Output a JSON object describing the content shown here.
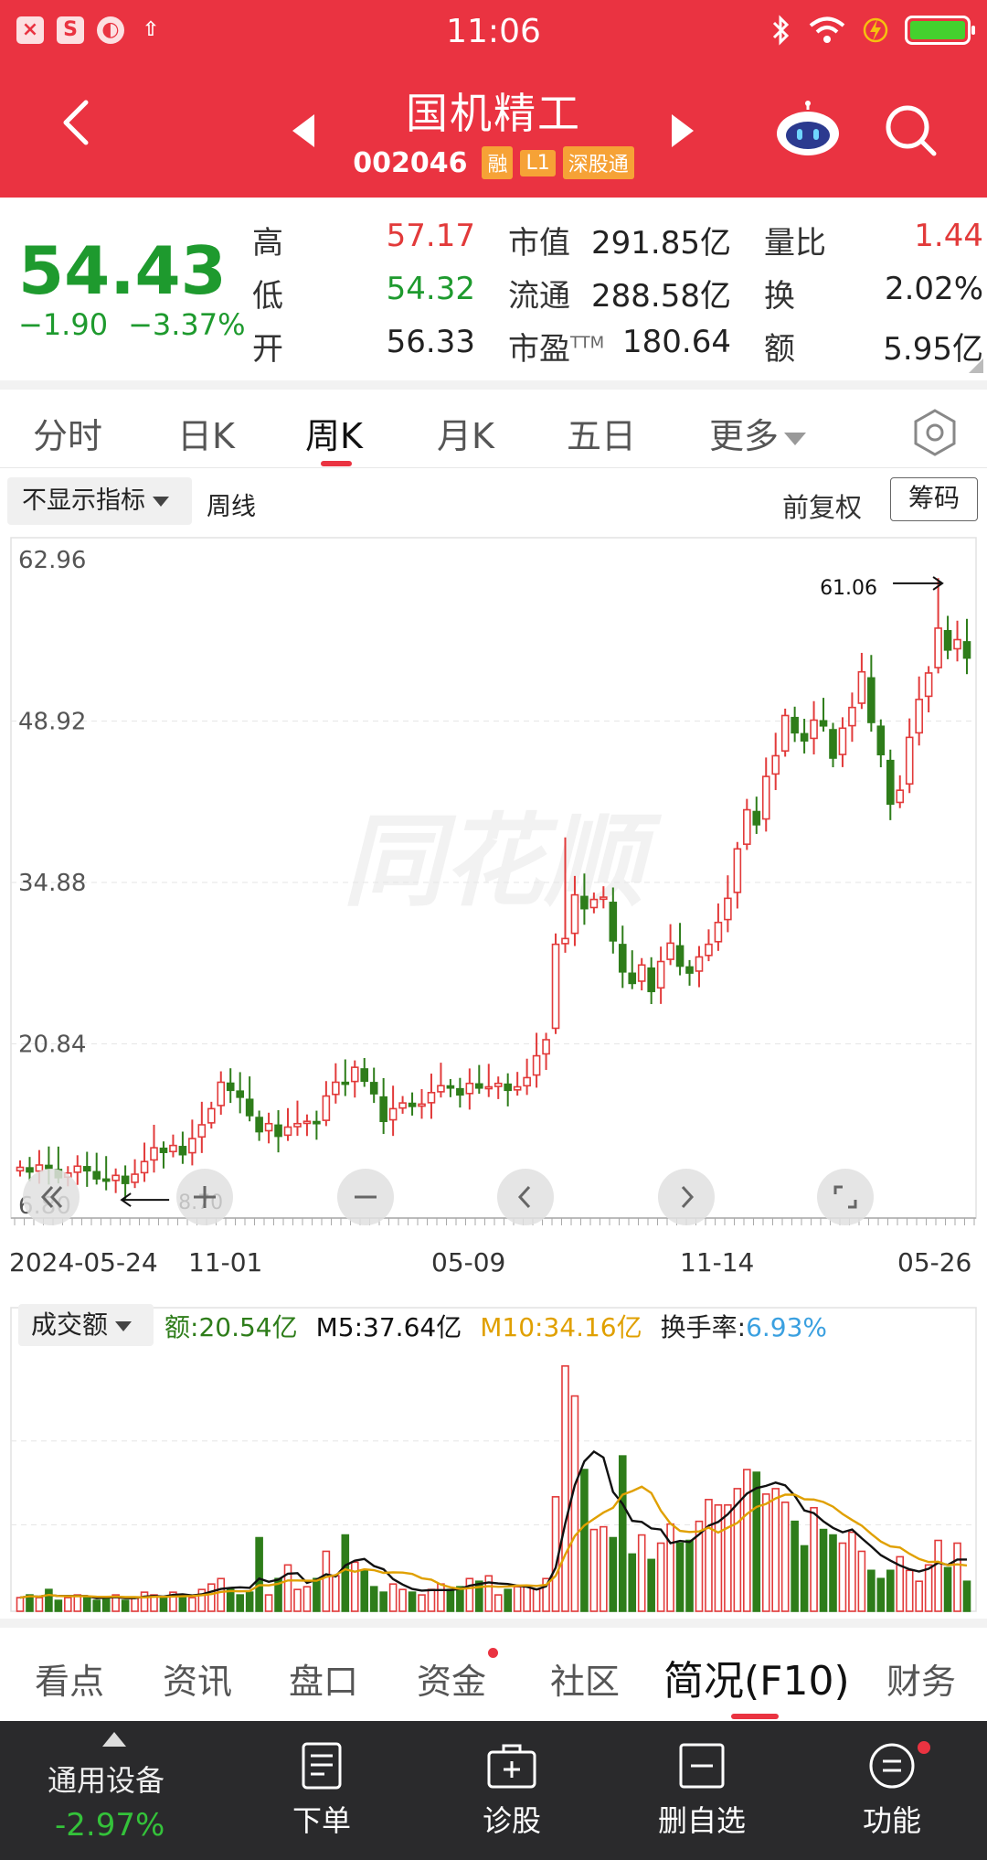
{
  "status_bar": {
    "time": "11:06"
  },
  "header": {
    "stock_name": "国机精工",
    "stock_code": "002046",
    "tags": [
      "融",
      "L1",
      "深股通"
    ]
  },
  "quote": {
    "price": "54.43",
    "change": "−1.90",
    "change_pct": "−3.37%",
    "high_label": "高",
    "high": "57.17",
    "low_label": "低",
    "low": "54.32",
    "open_label": "开",
    "open": "56.33",
    "mcap_label": "市值",
    "mcap": "291.85亿",
    "float_label": "流通",
    "float": "288.58亿",
    "pe_label": "市盈",
    "pe_sup": "TTM",
    "pe": "180.64",
    "vol_ratio_label": "量比",
    "vol_ratio": "1.44",
    "turnover_label": "换",
    "turnover": "2.02%",
    "amount_label": "额",
    "amount": "5.95亿"
  },
  "period_tabs": [
    "分时",
    "日K",
    "周K",
    "月K",
    "五日",
    "更多"
  ],
  "indicator": {
    "select": "不显示指标",
    "type": "周线",
    "adjust": "前复权",
    "chip_button": "筹码"
  },
  "watermark": "同花顺",
  "chart_data": [
    {
      "type": "candlestick",
      "period": "weekly",
      "ylim": [
        6.8,
        62.96
      ],
      "y_ticks": [
        "62.96",
        "48.92",
        "34.88",
        "20.84",
        "6.80"
      ],
      "x_tick_labels": [
        "2024-05-24",
        "11-01",
        "05-09",
        "11-14",
        "05-26"
      ],
      "max_annotation": "61.06",
      "min_annotation": "8.70",
      "closes": [
        10.1,
        9.7,
        10.3,
        10.0,
        9.2,
        9.6,
        10.2,
        9.8,
        9.1,
        8.9,
        9.4,
        8.7,
        9.5,
        10.6,
        11.8,
        11.4,
        12.0,
        11.2,
        12.6,
        13.8,
        15.2,
        17.5,
        16.8,
        16.2,
        14.6,
        13.2,
        13.9,
        12.8,
        13.6,
        13.9,
        14.1,
        13.9,
        16.3,
        17.5,
        17.4,
        18.8,
        17.6,
        16.5,
        14.1,
        15.2,
        15.7,
        15.4,
        15.6,
        16.6,
        17.2,
        17.0,
        16.4,
        17.4,
        17.0,
        17.1,
        17.4,
        16.8,
        17.1,
        17.9,
        19.8,
        21.2,
        29.5,
        30.0,
        33.8,
        32.6,
        33.4,
        33.6,
        29.8,
        27.1,
        26.1,
        27.7,
        25.4,
        28.0,
        29.6,
        27.6,
        27.0,
        28.4,
        29.5,
        31.4,
        33.5,
        37.8,
        41.2,
        39.9,
        44.1,
        45.9,
        49.4,
        47.9,
        47.2,
        49.0,
        48.5,
        45.7,
        48.3,
        50.1,
        53.2,
        48.8,
        46.0,
        41.7,
        42.9,
        47.5,
        50.8,
        53.1,
        57.0,
        55.1,
        56.0,
        54.4
      ],
      "candle_colors": "red = up (close ≥ open), green = down"
    },
    {
      "type": "bar",
      "title": "成交额",
      "series_label_amount": "额",
      "amount_value": "20.54亿",
      "m5_label": "M5",
      "m5_value": "37.64亿",
      "m10_label": "M10",
      "m10_value": "34.16亿",
      "turnover_label": "换手率",
      "turnover_value": "6.93%",
      "line_colors": {
        "m5": "#111111",
        "m10": "#e0a000"
      },
      "amounts_relative": [
        0.05,
        0.06,
        0.05,
        0.08,
        0.04,
        0.05,
        0.06,
        0.05,
        0.04,
        0.05,
        0.06,
        0.04,
        0.05,
        0.07,
        0.06,
        0.05,
        0.07,
        0.06,
        0.05,
        0.08,
        0.1,
        0.12,
        0.08,
        0.06,
        0.07,
        0.27,
        0.06,
        0.12,
        0.17,
        0.08,
        0.09,
        0.12,
        0.22,
        0.13,
        0.28,
        0.18,
        0.15,
        0.09,
        0.07,
        0.1,
        0.08,
        0.07,
        0.06,
        0.08,
        0.1,
        0.08,
        0.09,
        0.12,
        0.11,
        0.13,
        0.06,
        0.08,
        0.09,
        0.09,
        0.08,
        0.12,
        0.42,
        0.9,
        0.79,
        0.52,
        0.3,
        0.31,
        0.27,
        0.57,
        0.21,
        0.28,
        0.19,
        0.25,
        0.32,
        0.25,
        0.26,
        0.33,
        0.41,
        0.39,
        0.39,
        0.45,
        0.52,
        0.51,
        0.43,
        0.45,
        0.4,
        0.33,
        0.24,
        0.38,
        0.3,
        0.28,
        0.25,
        0.29,
        0.22,
        0.15,
        0.12,
        0.15,
        0.2,
        0.15,
        0.11,
        0.17,
        0.26,
        0.16,
        0.25,
        0.11
      ]
    }
  ],
  "date_axis": [
    "2024-05-24",
    "11-01",
    "05-09",
    "11-14",
    "05-26"
  ],
  "info_tabs": [
    "看点",
    "资讯",
    "盘口",
    "资金",
    "社区",
    "简况(F10)",
    "财务"
  ],
  "bottom_bar": {
    "sector_name": "通用设备",
    "sector_change": "-2.97%",
    "items": [
      "下单",
      "诊股",
      "删自选",
      "功能"
    ]
  }
}
